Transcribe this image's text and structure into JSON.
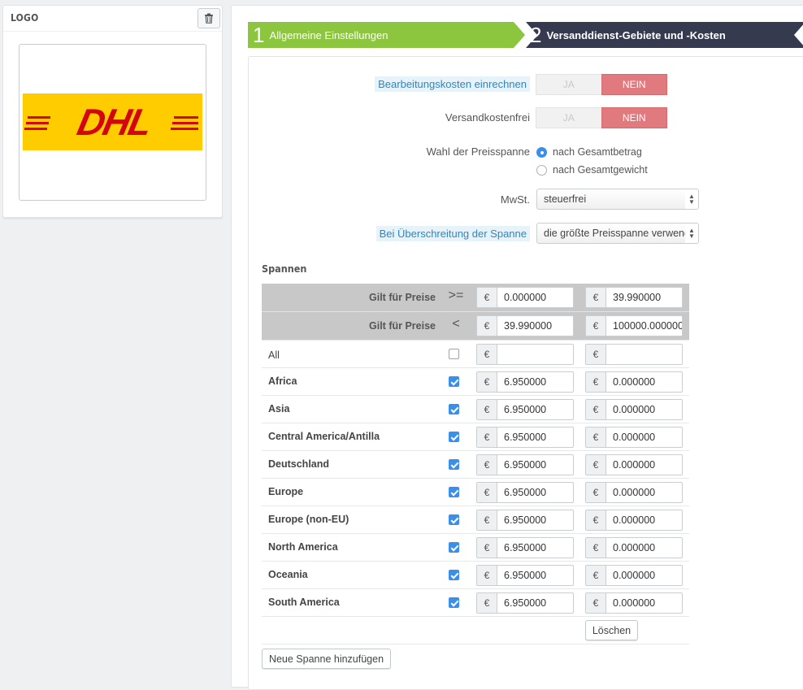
{
  "logo_panel": {
    "title": "LOGO",
    "delete_icon": "trash-icon",
    "image_alt": "DHL"
  },
  "wizard": {
    "step1": {
      "number": "1",
      "label": "Allgemeine Einstellungen",
      "color": "#8cc63f"
    },
    "step2": {
      "number": "2",
      "label": "Versanddienst-Gebiete und -Kosten",
      "color": "#363a4f"
    }
  },
  "form": {
    "handling": {
      "label": "Bearbeitungskosten einrechnen",
      "yes": "JA",
      "no": "NEIN",
      "value": "NEIN"
    },
    "free_shipping": {
      "label": "Versandkostenfrei",
      "yes": "JA",
      "no": "NEIN",
      "value": "NEIN"
    },
    "billing": {
      "label": "Wahl der Preisspanne",
      "options": [
        "nach Gesamtbetrag",
        "nach Gesamtgewicht"
      ],
      "selected": "nach Gesamtbetrag"
    },
    "tax": {
      "label": "MwSt.",
      "value": "steuerfrei"
    },
    "out_of_range": {
      "label": "Bei Überschreitung der Spanne",
      "value": "die größte Preisspanne verwenden"
    }
  },
  "ranges": {
    "title": "Spannen",
    "currency": "€",
    "header_ge": {
      "label": "Gilt für Preise",
      "op": ">=",
      "values": [
        "0.000000",
        "39.990000"
      ]
    },
    "header_lt": {
      "label": "Gilt für Preise",
      "op": "<",
      "values": [
        "39.990000",
        "100000.000000"
      ]
    },
    "all_row": {
      "label": "All",
      "checked": false,
      "values": [
        "",
        ""
      ]
    },
    "zones": [
      {
        "name": "Africa",
        "checked": true,
        "values": [
          "6.950000",
          "0.000000"
        ]
      },
      {
        "name": "Asia",
        "checked": true,
        "values": [
          "6.950000",
          "0.000000"
        ]
      },
      {
        "name": "Central America/Antilla",
        "checked": true,
        "values": [
          "6.950000",
          "0.000000"
        ]
      },
      {
        "name": "Deutschland",
        "checked": true,
        "values": [
          "6.950000",
          "0.000000"
        ]
      },
      {
        "name": "Europe",
        "checked": true,
        "values": [
          "6.950000",
          "0.000000"
        ]
      },
      {
        "name": "Europe (non-EU)",
        "checked": true,
        "values": [
          "6.950000",
          "0.000000"
        ]
      },
      {
        "name": "North America",
        "checked": true,
        "values": [
          "6.950000",
          "0.000000"
        ]
      },
      {
        "name": "Oceania",
        "checked": true,
        "values": [
          "6.950000",
          "0.000000"
        ]
      },
      {
        "name": "South America",
        "checked": true,
        "values": [
          "6.950000",
          "0.000000"
        ]
      }
    ],
    "delete_button": "Löschen",
    "add_button": "Neue Spanne hinzufügen"
  },
  "colors": {
    "toggle_active": "#e07a7e",
    "checkbox_checked": "#3b8fe8",
    "hint_text": "#2f86c2",
    "dhl_yellow": "#ffcc00",
    "dhl_red": "#d40511"
  }
}
